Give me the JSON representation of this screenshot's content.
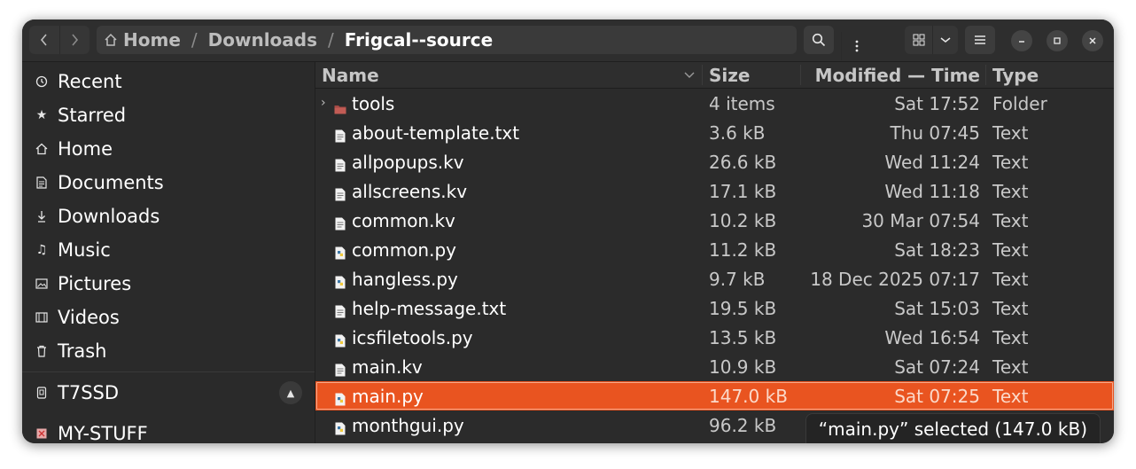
{
  "breadcrumb": [
    "Home",
    "Downloads",
    "Frigcal--source"
  ],
  "breadcrumb_separator": "/",
  "icons": {
    "back": "chevron-left-icon",
    "forward": "chevron-right-icon",
    "home": "home-icon",
    "path_menu": "vertical-dots-icon",
    "search": "search-icon",
    "view": "grid-icon",
    "view_menu": "chevron-down-icon",
    "main_menu": "hamburger-icon",
    "minimize": "minimize-icon",
    "maximize": "maximize-icon",
    "close": "close-icon"
  },
  "sidebar": {
    "places": [
      {
        "label": "Recent",
        "icon": "clock-icon"
      },
      {
        "label": "Starred",
        "icon": "star-icon"
      },
      {
        "label": "Home",
        "icon": "home-icon"
      },
      {
        "label": "Documents",
        "icon": "document-icon"
      },
      {
        "label": "Downloads",
        "icon": "download-icon"
      },
      {
        "label": "Music",
        "icon": "music-icon"
      },
      {
        "label": "Pictures",
        "icon": "picture-icon"
      },
      {
        "label": "Videos",
        "icon": "video-icon"
      },
      {
        "label": "Trash",
        "icon": "trash-icon"
      }
    ],
    "devices": [
      {
        "label": "T7SSD",
        "icon": "drive-icon",
        "eject": "eject-icon"
      },
      {
        "label": "MY-STUFF",
        "icon": "drive-error-icon"
      }
    ]
  },
  "columns": {
    "name": "Name",
    "size": "Size",
    "modified": "Modified — Time",
    "type": "Type"
  },
  "files": [
    {
      "name": "tools",
      "size": "4 items",
      "modified": "Sat 17:52",
      "type": "Folder",
      "kind": "folder"
    },
    {
      "name": "about-template.txt",
      "size": "3.6 kB",
      "modified": "Thu 07:45",
      "type": "Text",
      "kind": "text"
    },
    {
      "name": "allpopups.kv",
      "size": "26.6 kB",
      "modified": "Wed 11:24",
      "type": "Text",
      "kind": "text"
    },
    {
      "name": "allscreens.kv",
      "size": "17.1 kB",
      "modified": "Wed 11:18",
      "type": "Text",
      "kind": "text"
    },
    {
      "name": "common.kv",
      "size": "10.2 kB",
      "modified": "30 Mar 07:54",
      "type": "Text",
      "kind": "text"
    },
    {
      "name": "common.py",
      "size": "11.2 kB",
      "modified": "Sat 18:23",
      "type": "Text",
      "kind": "python"
    },
    {
      "name": "hangless.py",
      "size": "9.7 kB",
      "modified": "18 Dec 2025 07:17",
      "type": "Text",
      "kind": "python"
    },
    {
      "name": "help-message.txt",
      "size": "19.5 kB",
      "modified": "Sat 15:03",
      "type": "Text",
      "kind": "text"
    },
    {
      "name": "icsfiletools.py",
      "size": "13.5 kB",
      "modified": "Wed 16:54",
      "type": "Text",
      "kind": "python"
    },
    {
      "name": "main.kv",
      "size": "10.9 kB",
      "modified": "Sat 07:24",
      "type": "Text",
      "kind": "text"
    },
    {
      "name": "main.py",
      "size": "147.0 kB",
      "modified": "Sat 07:25",
      "type": "Text",
      "kind": "python",
      "selected": true
    },
    {
      "name": "monthgui.py",
      "size": "96.2 kB",
      "modified": "",
      "type": "",
      "kind": "python"
    }
  ],
  "status": "“main.py” selected  (147.0 kB)",
  "colors": {
    "accent": "#e95420",
    "window_bg": "#2c2c2c",
    "sidebar_bg": "#2a2a2a"
  }
}
